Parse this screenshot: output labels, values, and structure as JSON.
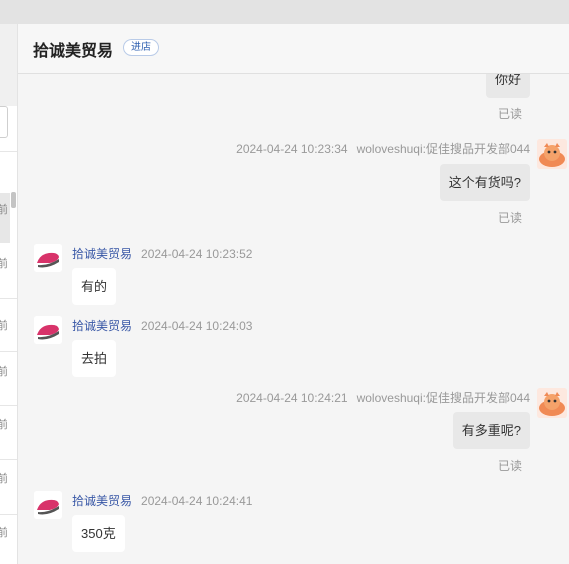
{
  "shop": {
    "name": "拾诚美贸易",
    "enter_label": "进店"
  },
  "left_fragments": [
    "前",
    "前",
    "前",
    "前",
    "前",
    "前",
    "前"
  ],
  "messages": [
    {
      "side": "right",
      "text": "你好",
      "read": "已读"
    },
    {
      "side": "right",
      "time": "2024-04-24 10:23:34",
      "sender": "woloveshuqi:促佳搜品开发部044",
      "text": "这个有货吗?",
      "read": "已读"
    },
    {
      "side": "left",
      "sender": "拾诚美贸易",
      "time": "2024-04-24 10:23:52",
      "text": "有的"
    },
    {
      "side": "left",
      "sender": "拾诚美贸易",
      "time": "2024-04-24 10:24:03",
      "text": "去拍"
    },
    {
      "side": "right",
      "time": "2024-04-24 10:24:21",
      "sender": "woloveshuqi:促佳搜品开发部044",
      "text": "有多重呢?",
      "read": "已读"
    },
    {
      "side": "left",
      "sender": "拾诚美贸易",
      "time": "2024-04-24 10:24:41",
      "text": "350克"
    }
  ]
}
